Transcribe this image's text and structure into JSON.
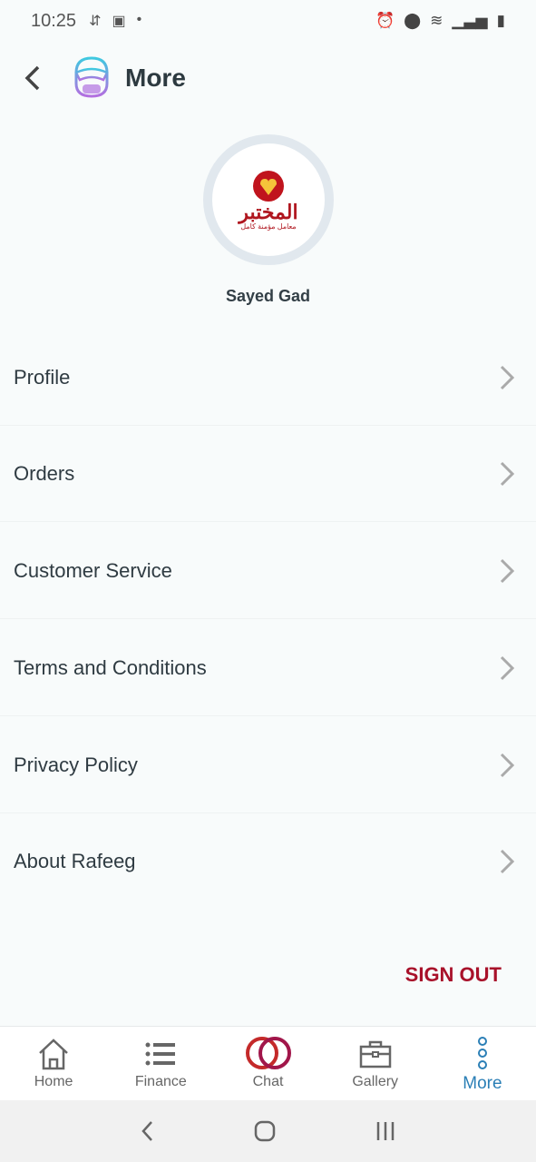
{
  "status_bar": {
    "time": "10:25"
  },
  "header": {
    "title": "More"
  },
  "profile": {
    "name": "Sayed Gad",
    "logo_text": "المختبر",
    "logo_subtext": "معامل مؤمنة كامل"
  },
  "menu": [
    {
      "label": "Profile"
    },
    {
      "label": "Orders"
    },
    {
      "label": "Customer Service"
    },
    {
      "label": "Terms and Conditions"
    },
    {
      "label": "Privacy Policy"
    },
    {
      "label": "About Rafeeg"
    }
  ],
  "sign_out": "SIGN OUT",
  "tabs": [
    {
      "label": "Home",
      "icon": "home-icon"
    },
    {
      "label": "Finance",
      "icon": "list-icon"
    },
    {
      "label": "Chat",
      "icon": "chat-icon"
    },
    {
      "label": "Gallery",
      "icon": "briefcase-icon"
    },
    {
      "label": "More",
      "icon": "more-icon",
      "active": true
    }
  ],
  "colors": {
    "accent": "#2b7fb6",
    "sign_out": "#a8112a"
  }
}
